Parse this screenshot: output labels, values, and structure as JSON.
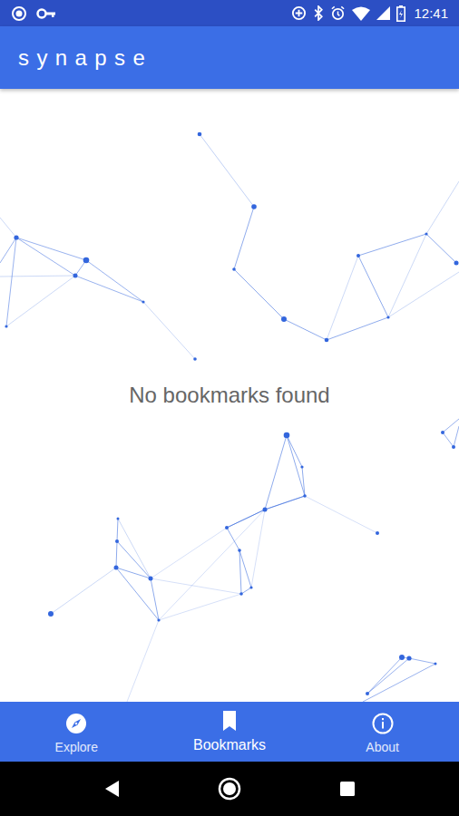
{
  "status_bar": {
    "time": "12:41"
  },
  "app_bar": {
    "title": "synapse"
  },
  "empty_state": {
    "message": "No bookmarks found"
  },
  "bottom_nav": [
    {
      "label": "Explore",
      "selected": false
    },
    {
      "label": "Bookmarks",
      "selected": true
    },
    {
      "label": "About",
      "selected": false
    }
  ]
}
